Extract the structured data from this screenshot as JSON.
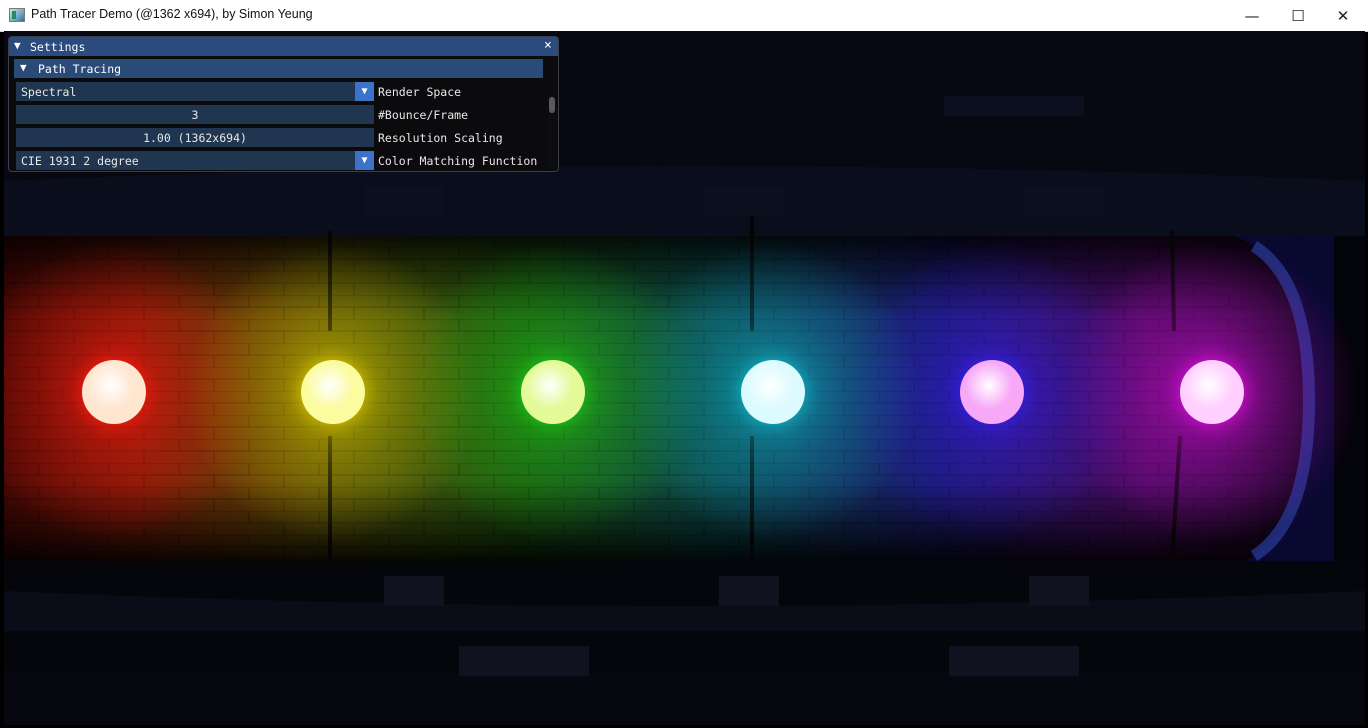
{
  "window": {
    "title": "Path Tracer Demo (@1362 x694), by Simon Yeung",
    "controls": {
      "minimize": "—",
      "maximize": "☐",
      "close": "✕"
    }
  },
  "settings_panel": {
    "title": "Settings",
    "close_glyph": "×",
    "section": {
      "label": "Path Tracing",
      "expanded": true
    },
    "rows": [
      {
        "value": "Spectral",
        "label": "Render Space",
        "type": "combo"
      },
      {
        "value": "3",
        "label": "#Bounce/Frame",
        "type": "slider"
      },
      {
        "value": "1.00 (1362x694)",
        "label": "Resolution Scaling",
        "type": "slider"
      },
      {
        "value": "CIE 1931 2 degree",
        "label": "Color Matching Function",
        "type": "combo"
      }
    ]
  },
  "scene": {
    "lights": [
      {
        "name": "red",
        "core": "#ffe6cf",
        "glow": "#ff1a10"
      },
      {
        "name": "yellow",
        "core": "#fbfba0",
        "glow": "#d8c800"
      },
      {
        "name": "green",
        "core": "#e3fa98",
        "glow": "#20c818"
      },
      {
        "name": "cyan",
        "core": "#dcfbff",
        "glow": "#12b8c8"
      },
      {
        "name": "violet",
        "core": "#f7a8f7",
        "glow": "#3a20f0"
      },
      {
        "name": "magenta",
        "core": "#ffd0ff",
        "glow": "#e010e0"
      }
    ]
  },
  "colors": {
    "panel_title_bg": "#2b4a7d",
    "widget_bg": "#20354f",
    "accent": "#3a73c9"
  }
}
